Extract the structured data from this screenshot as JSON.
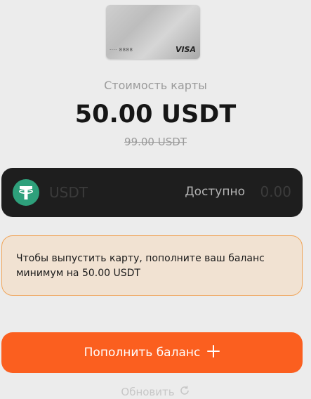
{
  "card": {
    "masked_number": "···· 8888",
    "brand": "VISA"
  },
  "cost": {
    "label": "Стоимость карты",
    "price": "50.00 USDT",
    "old_price": "99.00 USDT"
  },
  "balance": {
    "token": "USDT",
    "available_label": "Доступно",
    "available_value": "0.00",
    "icon": "tether-icon"
  },
  "notice": {
    "text": "Чтобы выпустить карту, пополните ваш баланс минимум на 50.00 USDT"
  },
  "actions": {
    "refill_label": "Пополнить баланс",
    "refill_icon": "plus-icon",
    "refresh_label": "Обновить",
    "refresh_icon": "refresh-icon"
  },
  "colors": {
    "accent": "#fb5f1f",
    "tether": "#2ea07b",
    "notice_border": "#f0a55a"
  }
}
